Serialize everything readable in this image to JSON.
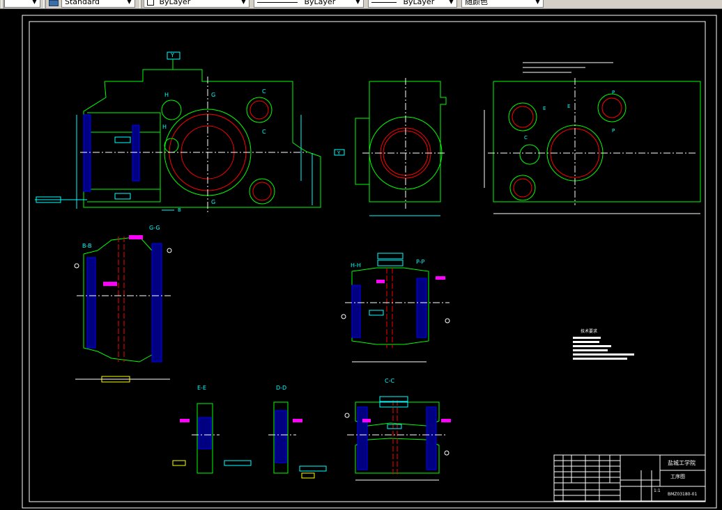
{
  "toolbar": {
    "text_style": "Standard",
    "layer": "ByLayer",
    "linetype": "ByLayer",
    "lineweight": "ByLayer",
    "color": "随颜色"
  },
  "views": {
    "section_bb": "B-B",
    "section_gg": "G-G",
    "section_hh": "H-H",
    "section_pp": "P-P",
    "section_ee": "E-E",
    "section_dd": "D-D",
    "section_cc": "C-C",
    "marker_y": "Y",
    "marker_y_side": "Y",
    "label_h": "H",
    "label_g": "G",
    "label_c": "C",
    "label_e": "E",
    "label_p": "P",
    "label_b": "B"
  },
  "tech_requirements": {
    "title": "技术要求"
  },
  "title_block": {
    "school": "盐城工学院",
    "drawing_type": "工序图",
    "drawing_number": "BMZ03180-01",
    "scale": "1:1"
  }
}
